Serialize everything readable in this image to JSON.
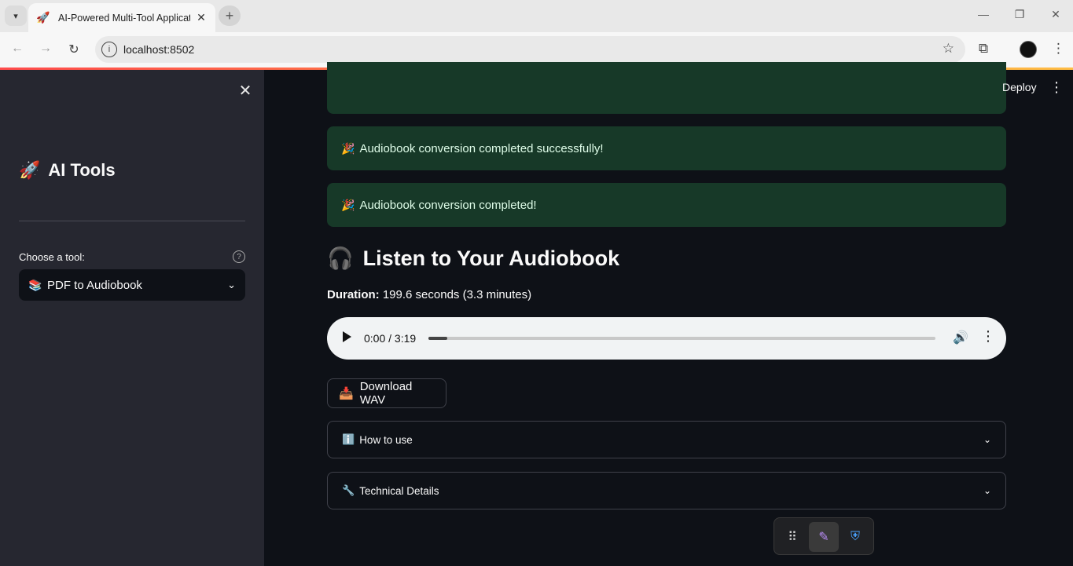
{
  "browser": {
    "tab_title": "AI-Powered Multi-Tool Applicat",
    "tab_favicon": "🚀",
    "url": "localhost:8502"
  },
  "sidebar": {
    "title_icon": "🚀",
    "title": "AI Tools",
    "select_label": "Choose a tool:",
    "select_icon": "📚",
    "selected_tool": "PDF to Audiobook"
  },
  "main": {
    "deploy_label": "Deploy",
    "alerts": [
      {
        "icon": "🎉",
        "text": "Audiobook conversion completed successfully!"
      },
      {
        "icon": "🎉",
        "text": "Audiobook conversion completed!"
      }
    ],
    "heading_icon": "🎧",
    "heading": "Listen to Your Audiobook",
    "duration_label": "Duration:",
    "duration_value": "199.6 seconds (3.3 minutes)",
    "audio": {
      "time": "0:00 / 3:19",
      "progress_fraction": 0.0
    },
    "download_icon": "📥",
    "download_label": "Download WAV",
    "expanders": [
      {
        "icon": "ℹ️",
        "label": "How to use"
      },
      {
        "icon": "🔧",
        "label": "Technical Details"
      }
    ]
  },
  "icons": {
    "tab_menu": "chevron-down-icon",
    "new_tab": "plus-icon",
    "back": "arrow-left-icon",
    "forward": "arrow-right-icon",
    "reload": "reload-icon",
    "site_info": "info-icon",
    "bookmark": "star-icon",
    "extensions": "puzzle-icon",
    "menu": "kebab-icon"
  },
  "colors": {
    "success_bg": "#173928",
    "success_text": "#dffde9",
    "sidebar_bg": "#262730",
    "main_bg": "#0e1117",
    "accent_gradient_start": "#ff4b4b",
    "accent_gradient_end": "#ffbd45"
  }
}
